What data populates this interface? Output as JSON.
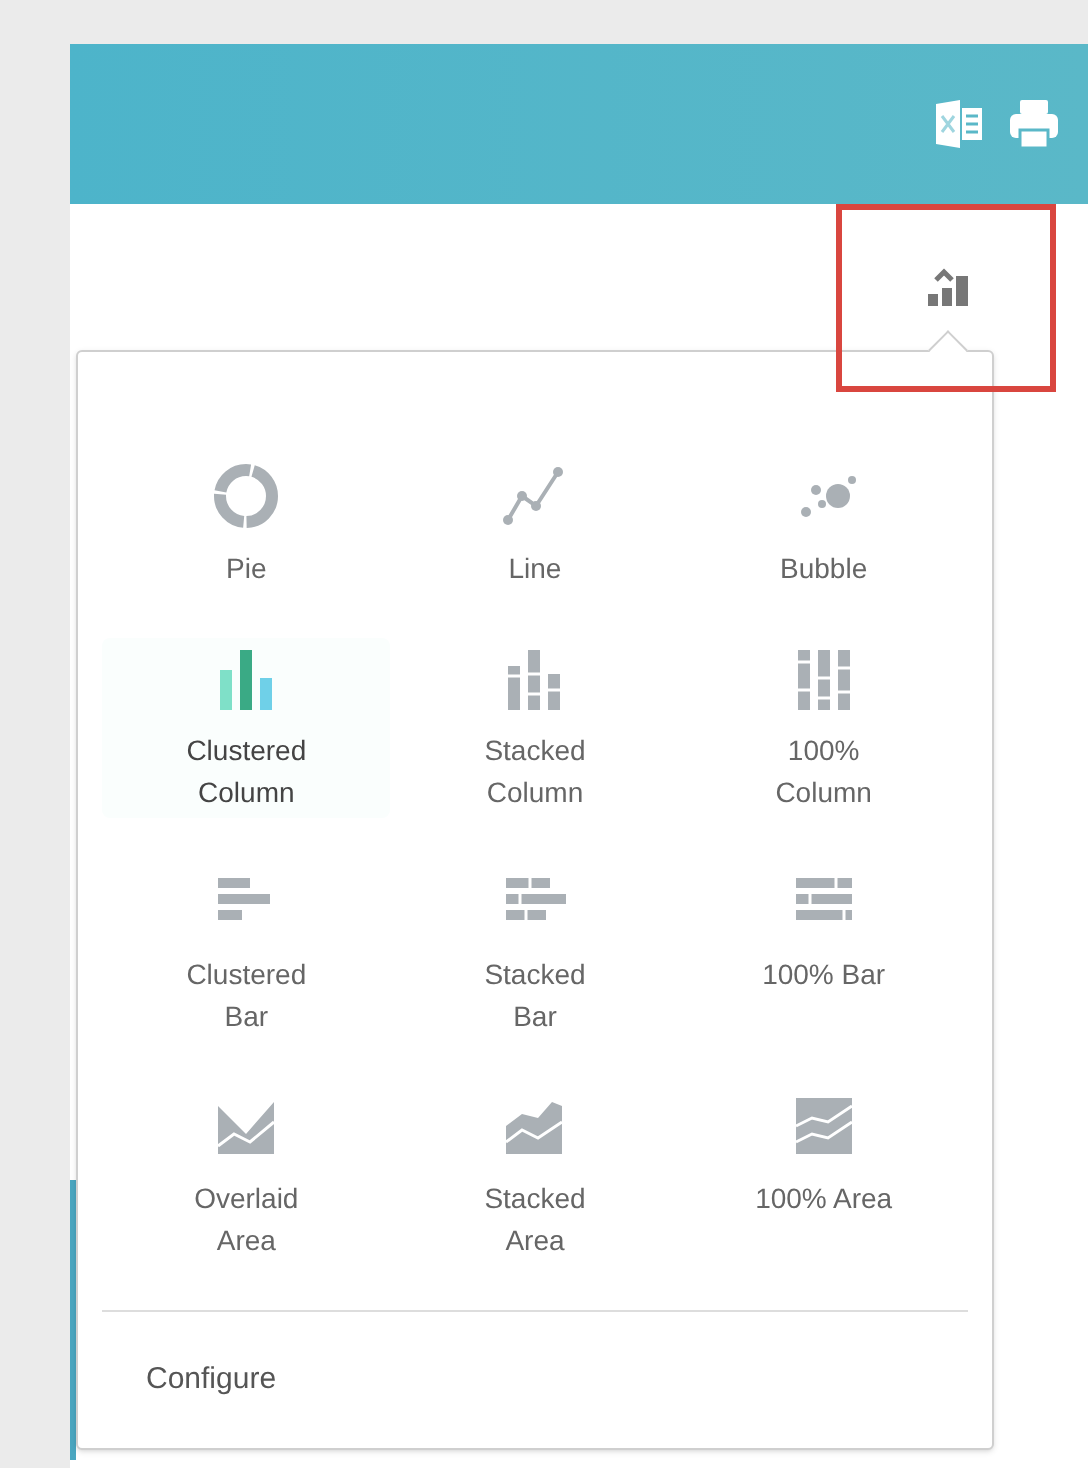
{
  "chart_menu": {
    "items": [
      {
        "kind": "pie",
        "label": "Pie",
        "selected": false
      },
      {
        "kind": "line",
        "label": "Line",
        "selected": false
      },
      {
        "kind": "bubble",
        "label": "Bubble",
        "selected": false
      },
      {
        "kind": "clustered_column",
        "label": "Clustered Column",
        "selected": true
      },
      {
        "kind": "stacked_column",
        "label": "Stacked Column",
        "selected": false
      },
      {
        "kind": "percent_column",
        "label": "100% Column",
        "selected": false
      },
      {
        "kind": "clustered_bar",
        "label": "Clustered Bar",
        "selected": false
      },
      {
        "kind": "stacked_bar",
        "label": "Stacked Bar",
        "selected": false
      },
      {
        "kind": "percent_bar",
        "label": "100% Bar",
        "selected": false
      },
      {
        "kind": "overlaid_area",
        "label": "Overlaid Area",
        "selected": false
      },
      {
        "kind": "stacked_area",
        "label": "Stacked Area",
        "selected": false
      },
      {
        "kind": "percent_area",
        "label": "100% Area",
        "selected": false
      }
    ],
    "footer": "Configure"
  }
}
